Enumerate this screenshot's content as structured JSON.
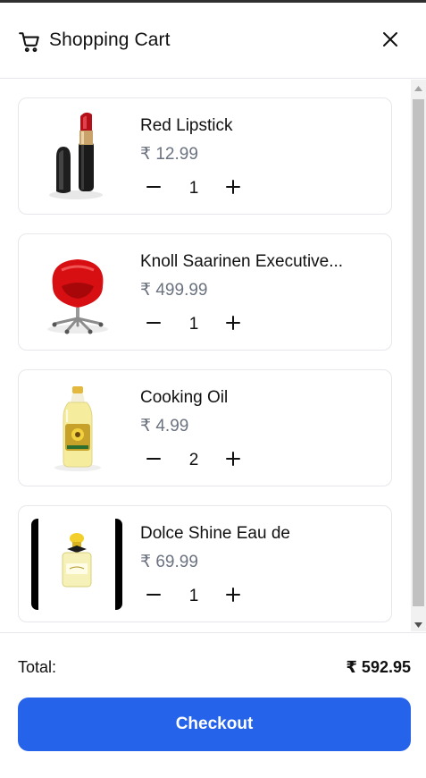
{
  "header": {
    "title": "Shopping Cart",
    "cart_icon": "cart-icon",
    "close_icon": "close-icon"
  },
  "items": [
    {
      "name": "Red Lipstick",
      "price": "₹ 12.99",
      "quantity": "1",
      "image": "red-lipstick"
    },
    {
      "name": "Knoll Saarinen Executive...",
      "price": "₹ 499.99",
      "quantity": "1",
      "image": "red-office-chair"
    },
    {
      "name": "Cooking Oil",
      "price": "₹ 4.99",
      "quantity": "2",
      "image": "cooking-oil-bottle"
    },
    {
      "name": "Dolce Shine Eau de",
      "price": "₹ 69.99",
      "quantity": "1",
      "image": "perfume-bottle"
    }
  ],
  "footer": {
    "total_label": "Total:",
    "total_value": "₹ 592.95",
    "checkout_label": "Checkout"
  },
  "colors": {
    "accent": "#2563eb",
    "price_text": "#6b7280",
    "border": "#e5e7eb"
  }
}
